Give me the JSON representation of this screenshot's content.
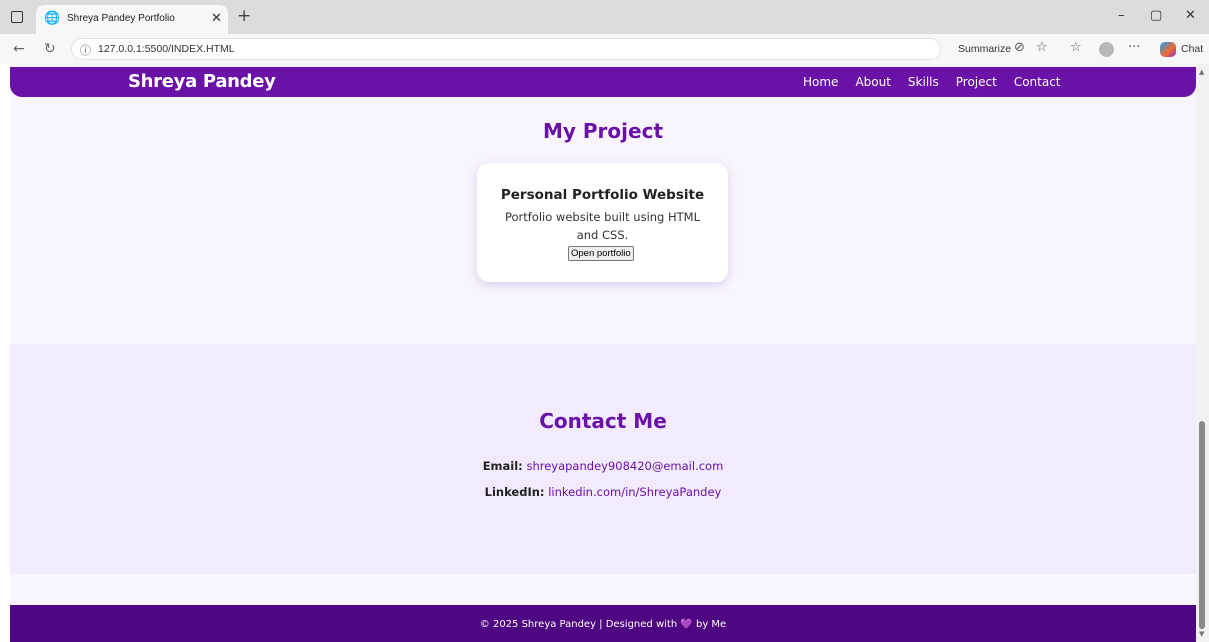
{
  "browser": {
    "tab_title": "Shreya Pandey Portfolio",
    "url": "127.0.0.1:5500/INDEX.HTML",
    "summarize_label": "Summarize",
    "chat_label": "Chat",
    "icons": [
      "sidebar-toggle-icon",
      "globe-icon",
      "close-icon",
      "plus-icon",
      "minimize-icon",
      "restore-icon",
      "back-icon",
      "refresh-icon",
      "info-icon",
      "translate-icon",
      "star-icon",
      "favorites-icon",
      "profile-icon",
      "more-icon",
      "copilot-icon"
    ]
  },
  "navbar": {
    "brand": "Shreya Pandey",
    "links": [
      "Home",
      "About",
      "Skills",
      "Project",
      "Contact"
    ]
  },
  "projects": {
    "title": "My Project",
    "card": {
      "title": "Personal Portfolio Website",
      "description": "Portfolio website built using HTML and CSS.",
      "button": "Open portfolio"
    }
  },
  "contact": {
    "title": "Contact Me",
    "email_label": "Email:",
    "email": "shreyapandey908420@email.com",
    "linkedin_label": "LinkedIn:",
    "linkedin": "linkedin.com/in/ShreyaPandey"
  },
  "footer": {
    "text_before": "© 2025 Shreya Pandey | Designed with",
    "heart": "💜",
    "text_after": "by Me"
  },
  "colors": {
    "primary": "#6a11a8",
    "footer": "#4e0682",
    "page_bg": "#f9f5ff",
    "contact_bg": "#f1ebfd"
  }
}
